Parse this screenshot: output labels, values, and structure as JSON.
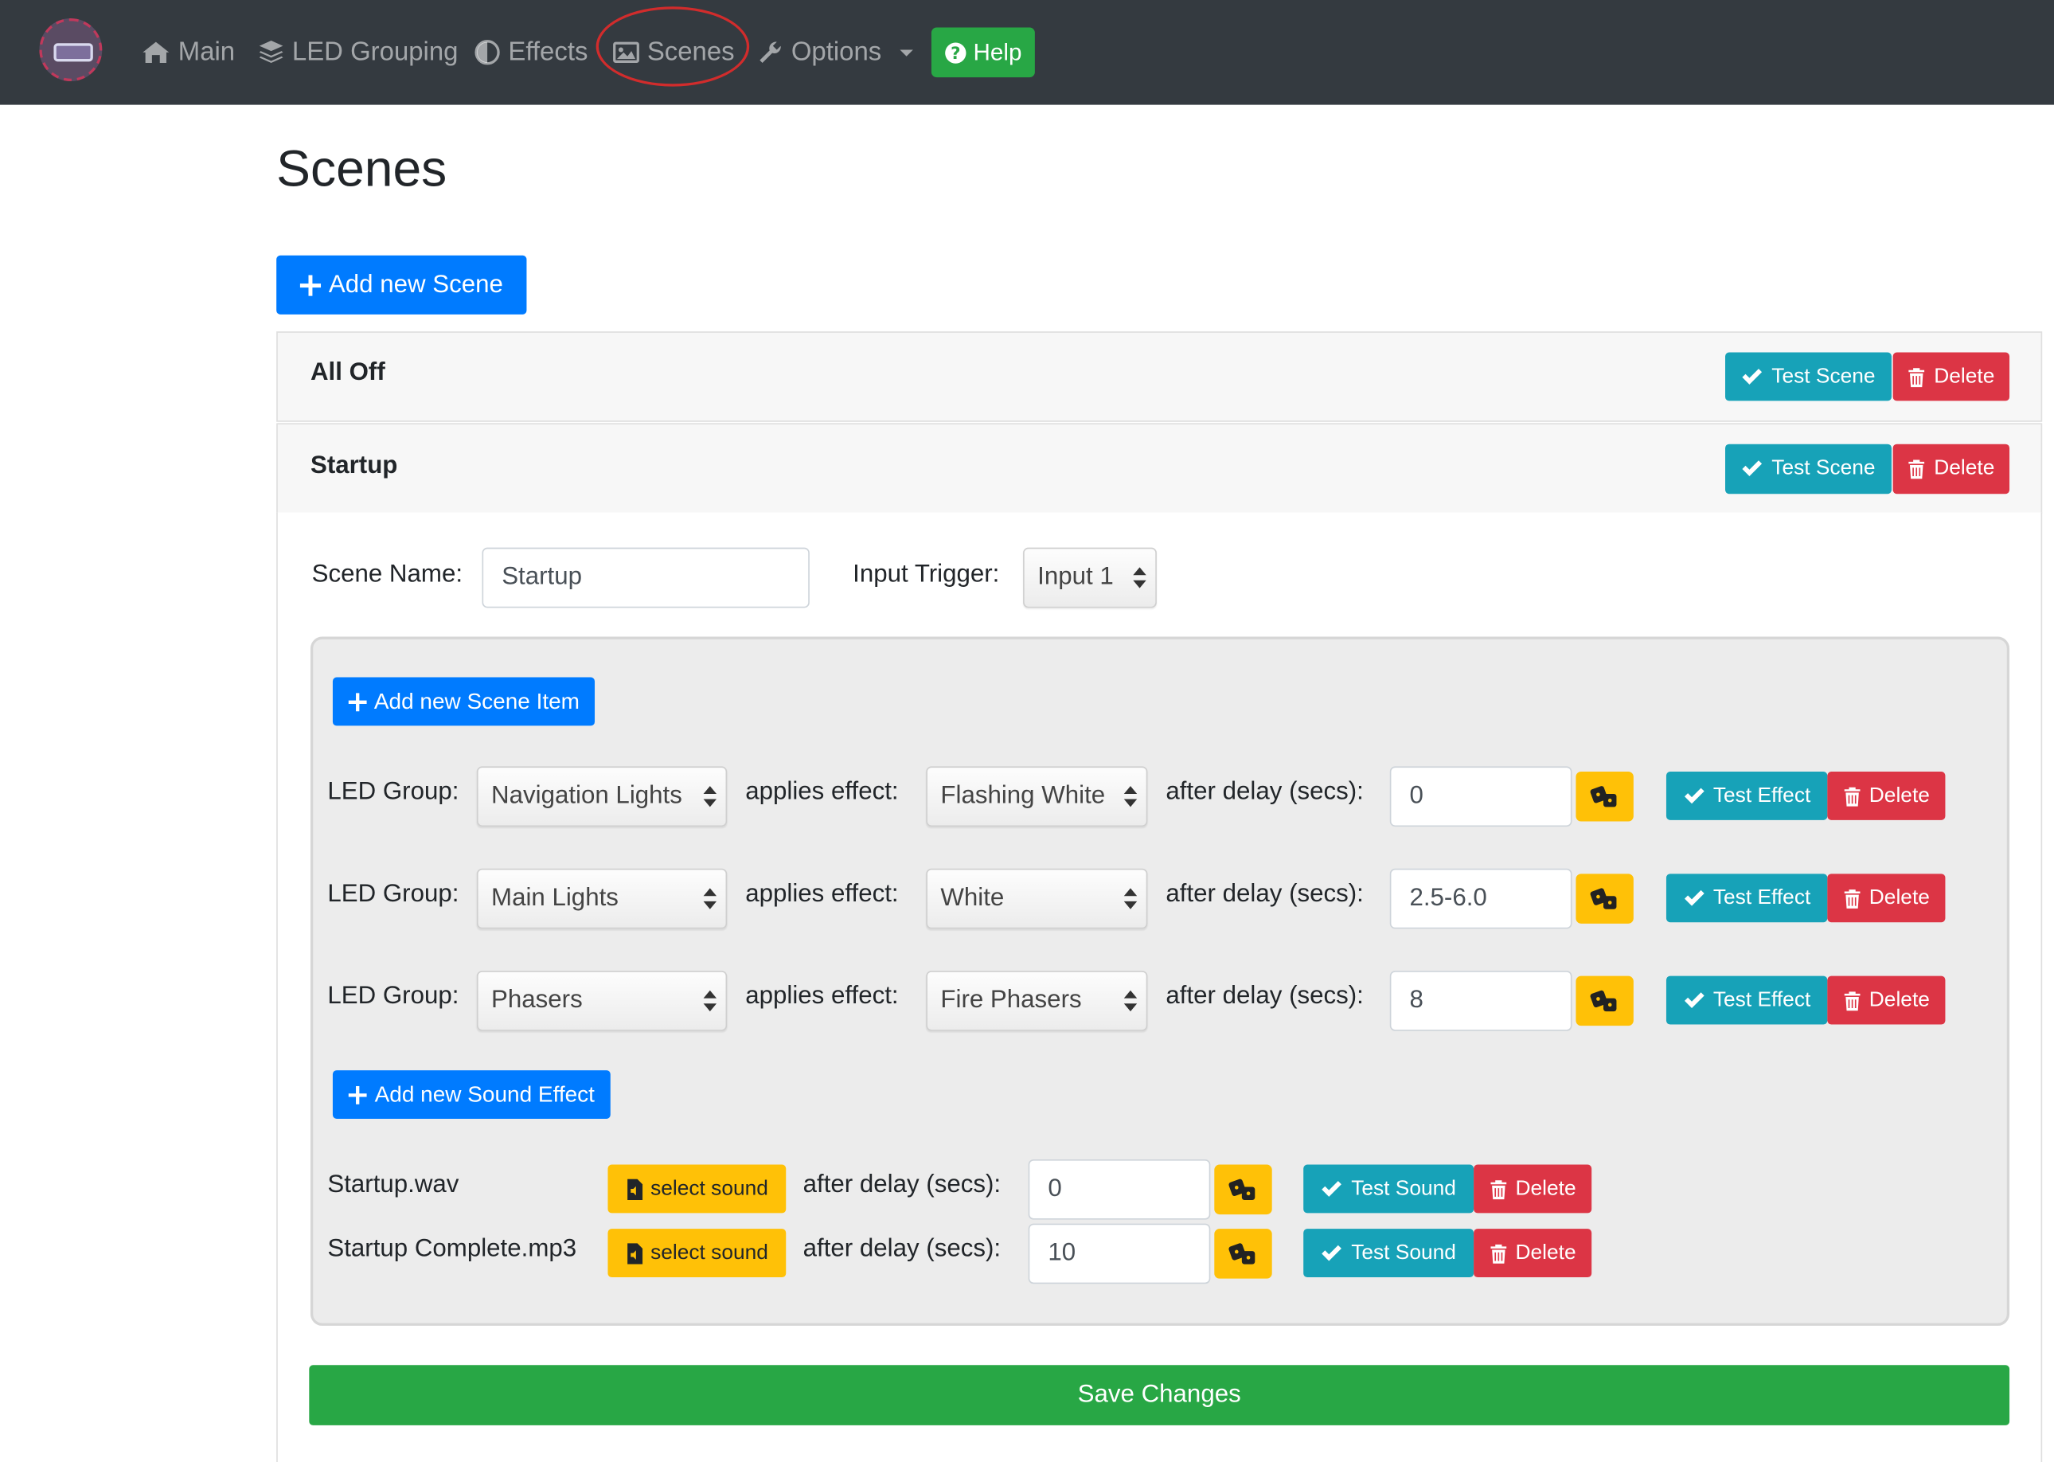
{
  "nav": {
    "items": [
      {
        "label": "Main",
        "icon": "home-icon"
      },
      {
        "label": "LED Grouping",
        "icon": "layers-icon"
      },
      {
        "label": "Effects",
        "icon": "adjust-icon"
      },
      {
        "label": "Scenes",
        "icon": "image-icon"
      },
      {
        "label": "Options",
        "icon": "wrench-icon"
      }
    ],
    "help_label": "Help"
  },
  "page": {
    "title": "Scenes",
    "add_scene_label": "Add new Scene"
  },
  "scenes": [
    {
      "title": "All Off",
      "test_label": "Test Scene",
      "delete_label": "Delete"
    },
    {
      "title": "Startup",
      "test_label": "Test Scene",
      "delete_label": "Delete"
    }
  ],
  "editor": {
    "scene_name_label": "Scene Name:",
    "scene_name_value": "Startup",
    "input_trigger_label": "Input Trigger:",
    "input_trigger_value": "Input 1",
    "add_item_label": "Add new Scene Item",
    "led_group_label": "LED Group:",
    "applies_effect_label": "applies effect:",
    "after_delay_label": "after delay (secs):",
    "test_effect_label": "Test Effect",
    "delete_label": "Delete",
    "items": [
      {
        "group": "Navigation Lights",
        "effect": "Flashing White",
        "delay": "0"
      },
      {
        "group": "Main Lights",
        "effect": "White",
        "delay": "2.5-6.0"
      },
      {
        "group": "Phasers",
        "effect": "Fire Phasers",
        "delay": "8"
      }
    ],
    "add_sound_label": "Add new Sound Effect",
    "select_sound_label": "select sound",
    "test_sound_label": "Test Sound",
    "sounds": [
      {
        "file": "Startup.wav",
        "delay": "0"
      },
      {
        "file": "Startup Complete.mp3",
        "delay": "10"
      }
    ],
    "save_label": "Save Changes"
  },
  "colors": {
    "navbar": "#343a40",
    "primary": "#007bff",
    "info": "#17a2b8",
    "danger": "#dc3545",
    "warning": "#ffc107",
    "success": "#28a745",
    "highlight": "#d12c2c"
  }
}
